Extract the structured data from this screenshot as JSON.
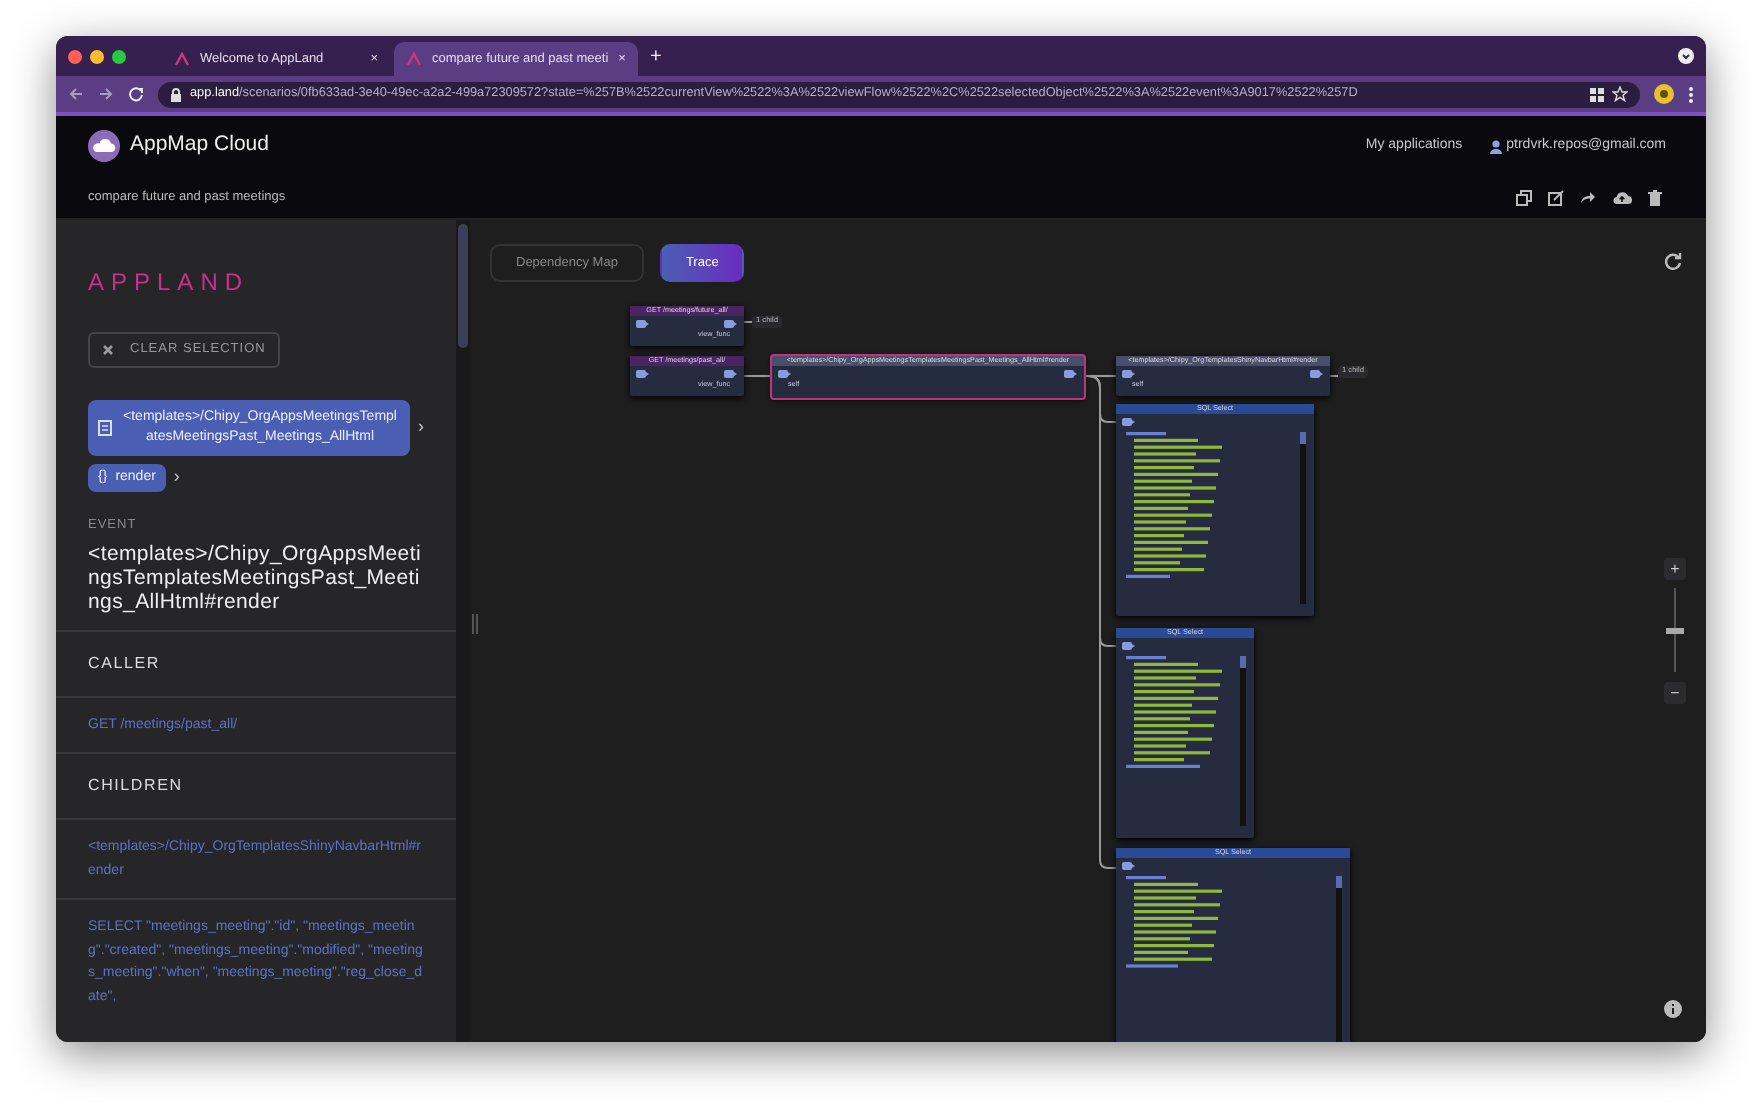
{
  "browser": {
    "tabs": [
      {
        "title": "Welcome to AppLand",
        "close": "×",
        "selected": false
      },
      {
        "title": "compare future and past meeti",
        "close": "×",
        "selected": true
      }
    ],
    "new_tab": "+",
    "url_host": "app.land",
    "url_path": "/scenarios/0fb633ad-3e40-49ec-a2a2-499a72309572?state=%257B%2522currentView%2522%3A%2522viewFlow%2522%2C%2522selectedObject%2522%3A%2522event%3A9017%2522%257D"
  },
  "header": {
    "app_name": "AppMap Cloud",
    "nav_link": "My applications",
    "user": "ptrdvrk.repos@gmail.com",
    "scenario_title": "compare future and past meetings"
  },
  "sidebar": {
    "brand": "APPLAND",
    "clear_button": "CLEAR SELECTION",
    "breadcrumbs": [
      {
        "kind": "class",
        "label": "<templates>/Chipy_OrgAppsMeetingsTemplatesMeetingsPast_Meetings_AllHtml",
        "arrow": "›"
      },
      {
        "kind": "function",
        "icon": "{}",
        "label": "render",
        "arrow": "›"
      }
    ],
    "event_label": "EVENT",
    "event_title": "<templates>/Chipy_OrgAppsMeetingsTemplatesMeetingsPast_Meetings_AllHtml#render",
    "sections": [
      {
        "heading": "CALLER",
        "links": [
          "GET /meetings/past_all/"
        ]
      },
      {
        "heading": "CHILDREN",
        "links": [
          "<templates>/Chipy_OrgTemplatesShinyNavbarHtml#render",
          "SELECT \"meetings_meeting\".\"id\", \"meetings_meeting\".\"created\", \"meetings_meeting\".\"modified\", \"meetings_meeting\".\"when\", \"meetings_meeting\".\"reg_close_date\","
        ]
      }
    ]
  },
  "graph": {
    "view_tabs": [
      {
        "label": "Dependency Map",
        "selected": false
      },
      {
        "label": "Trace",
        "selected": true
      }
    ],
    "nodes": [
      {
        "kind": "http",
        "title": "GET /meetings/future_all/",
        "port": "view_func",
        "child_count": "1 child",
        "selected": false
      },
      {
        "kind": "http",
        "title": "GET /meetings/past_all/",
        "port": "view_func",
        "selected": false
      },
      {
        "kind": "function",
        "title": "<templates>/Chipy_OrgAppsMeetingsTemplatesMeetingsPast_Meetings_AllHtml#render",
        "port": "self",
        "selected": true
      },
      {
        "kind": "function",
        "title": "<templates>/Chipy_OrgTemplatesShinyNavbarHtml#render",
        "port": "self",
        "child_count": "1 child",
        "selected": false
      },
      {
        "kind": "sql",
        "title": "SQL Select",
        "selected": false
      },
      {
        "kind": "sql",
        "title": "SQL Select",
        "selected": false
      },
      {
        "kind": "sql",
        "title": "SQL Select",
        "selected": false
      }
    ],
    "zoom": {
      "zoom_in": "+",
      "zoom_out": "−",
      "level": 0.5
    }
  }
}
